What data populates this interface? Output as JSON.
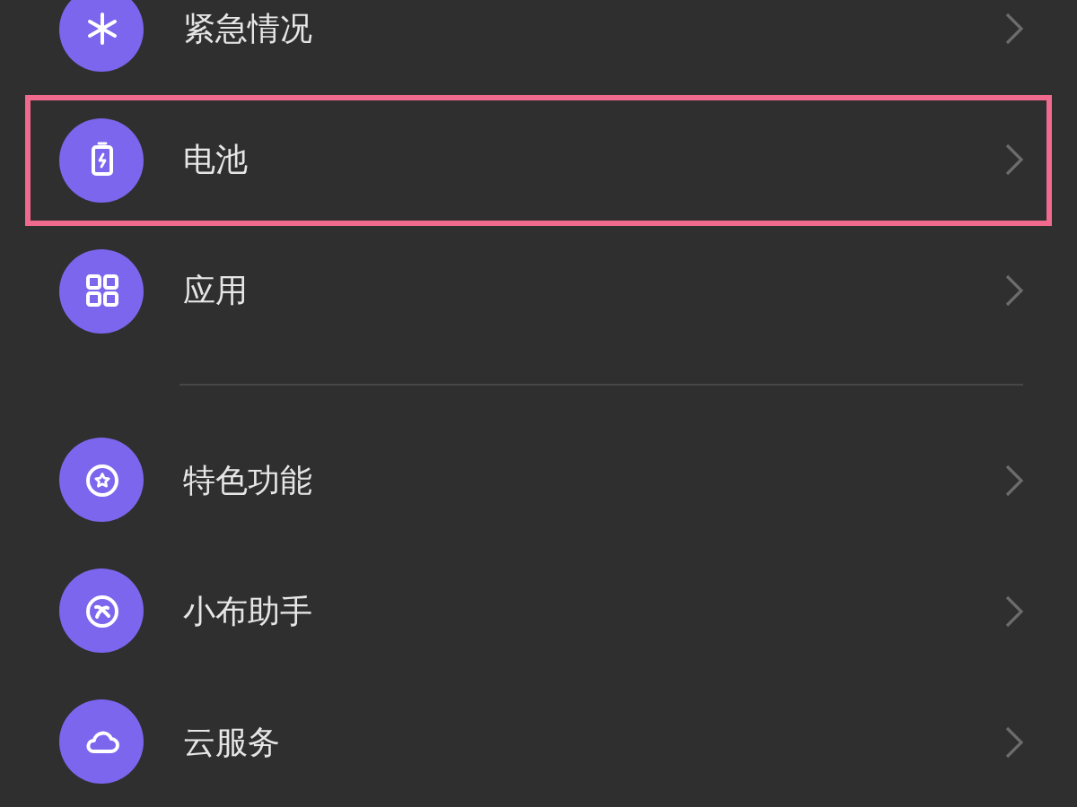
{
  "sections": [
    {
      "items": [
        {
          "label": "紧急情况",
          "kind": "asterisk",
          "highlighted": false
        },
        {
          "label": "电池",
          "kind": "battery",
          "highlighted": true
        },
        {
          "label": "应用",
          "kind": "grid",
          "highlighted": false
        }
      ]
    },
    {
      "items": [
        {
          "label": "特色功能",
          "kind": "star",
          "highlighted": false
        },
        {
          "label": "小布助手",
          "kind": "assistant",
          "highlighted": false
        },
        {
          "label": "云服务",
          "kind": "cloud",
          "highlighted": false
        }
      ]
    }
  ]
}
